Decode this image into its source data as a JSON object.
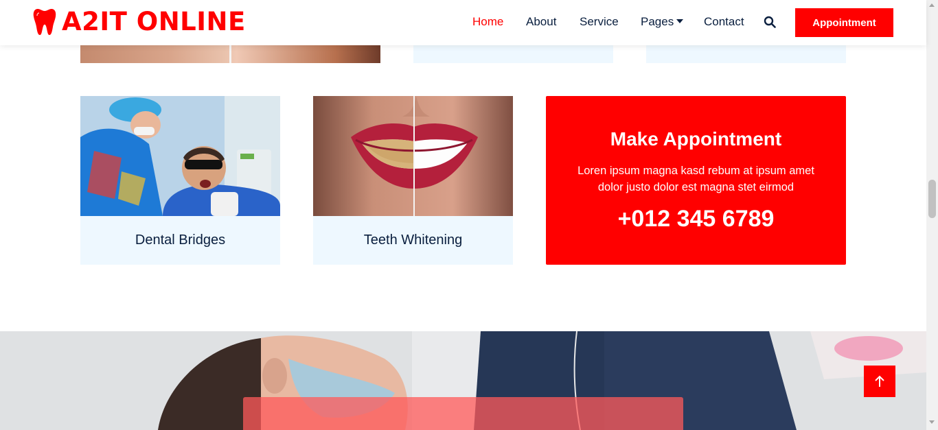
{
  "brand": {
    "name": "A2IT ONLINE",
    "icon": "tooth-icon",
    "color": "#ff0000"
  },
  "nav": {
    "items": [
      {
        "label": "Home",
        "active": true
      },
      {
        "label": "About",
        "active": false
      },
      {
        "label": "Service",
        "active": false
      },
      {
        "label": "Pages",
        "active": false,
        "has_dropdown": true
      },
      {
        "label": "Contact",
        "active": false
      }
    ],
    "search_icon": "search-icon",
    "appointment_label": "Appointment"
  },
  "services": [
    {
      "title": "Dental Bridges"
    },
    {
      "title": "Teeth Whitening"
    }
  ],
  "appointment_box": {
    "title": "Make Appointment",
    "text": "Loren ipsum magna kasd rebum at ipsum amet dolor justo dolor est magna stet eirmod",
    "phone": "+012 345 6789"
  },
  "scroll_top_icon": "arrow-up-icon",
  "colors": {
    "accent": "#ff0000",
    "dark": "#091e3e",
    "light_card": "#eef8ff"
  }
}
